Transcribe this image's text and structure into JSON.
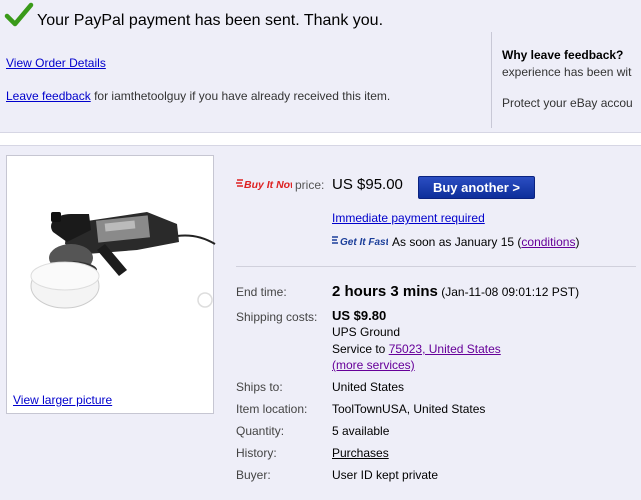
{
  "confirmation": {
    "title": "Your PayPal payment has been sent. Thank you.",
    "order_link": "View Order Details",
    "feedback_link": "Leave feedback",
    "feedback_text": " for iamthetoolguy if you have already received this item.",
    "why_title": "Why leave feedback?",
    "why_text": "experience has been wit",
    "protect_text": "Protect your eBay accou",
    "icon": "checkmark-icon",
    "check_color": "#3a9a1a"
  },
  "item": {
    "image_icon": "polisher-image",
    "larger_link": "View larger picture",
    "buy_it_now": "Buy It Now",
    "price_label": "price:",
    "price": "US $95.00",
    "buy_button": "Buy another >",
    "immediate_payment": "Immediate payment required",
    "get_it_fast": "Get It Fast",
    "asap_prefix": "As soon as January 15 (",
    "conditions_link": "conditions",
    "asap_suffix": ")",
    "end_time_label": "End time:",
    "end_time": "2 hours 3 mins",
    "end_date": "(Jan-11-08 09:01:12 PST)",
    "shipping_label": "Shipping costs:",
    "shipping_cost": "US $9.80",
    "shipping_method": "UPS Ground",
    "service_to_prefix": "Service to ",
    "service_to_link": "75023, United States",
    "more_services": "(more services)",
    "ships_to_label": "Ships to:",
    "ships_to": "United States",
    "location_label": "Item location:",
    "location": "ToolTownUSA, United States",
    "quantity_label": "Quantity:",
    "quantity": "5 available",
    "history_label": "History:",
    "history_link": "Purchases",
    "buyer_label": "Buyer:",
    "buyer": "User ID kept private",
    "brand_color": "#0d2e9a"
  }
}
